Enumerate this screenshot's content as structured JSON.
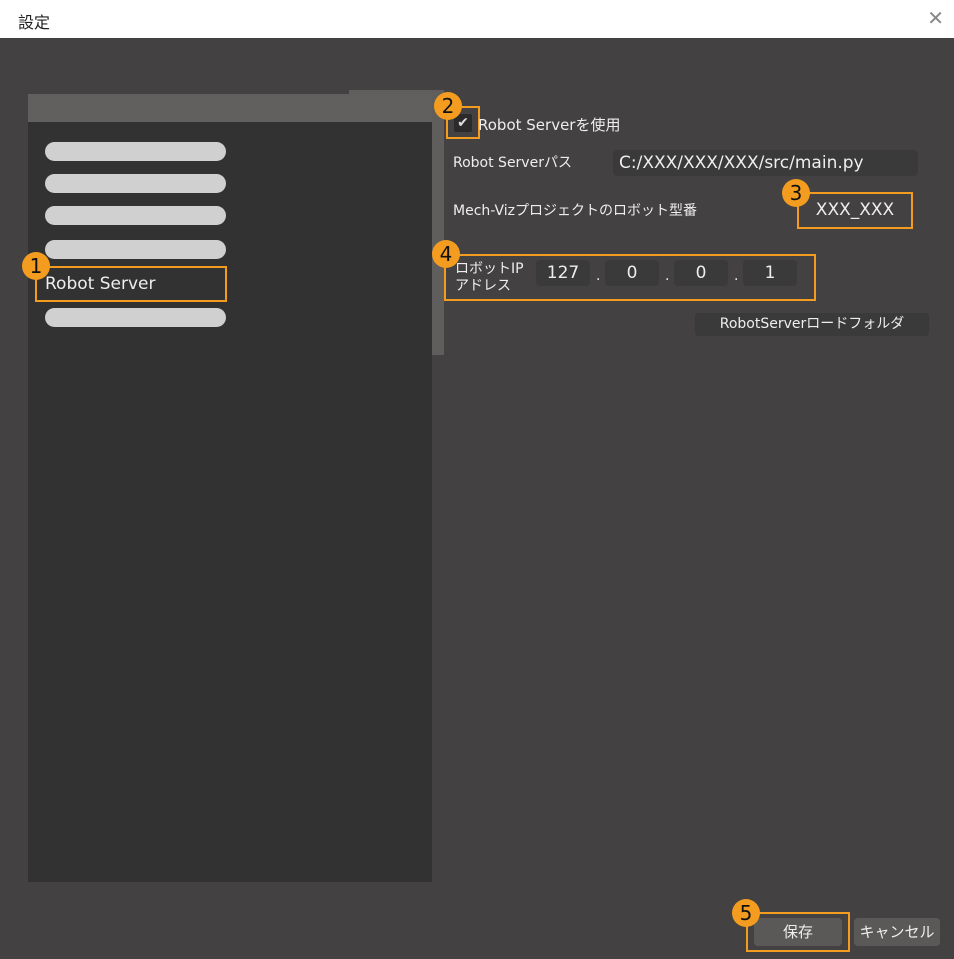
{
  "window": {
    "title": "設定",
    "close_icon": "close-icon"
  },
  "sidebar": {
    "selected_item": "Robot Server"
  },
  "form": {
    "use_robot_server_label": "Robot Serverを使用",
    "use_robot_server_checked": true,
    "path_label": "Robot Serverパス",
    "path_value": "C:/XXX/XXX/XXX/src/main.py",
    "model_label": "Mech-Vizプロジェクトのロボット型番",
    "model_value": "XXX_XXX",
    "ip_label_line1": "ロボットIP",
    "ip_label_line2": "アドレス",
    "ip": [
      "127",
      "0",
      "0",
      "1"
    ],
    "load_folder_button": "RobotServerロードフォルダ"
  },
  "footer": {
    "save": "保存",
    "cancel": "キャンセル"
  },
  "badges": [
    "1",
    "2",
    "3",
    "4",
    "5"
  ],
  "colors": {
    "accent": "#f39c1f"
  }
}
